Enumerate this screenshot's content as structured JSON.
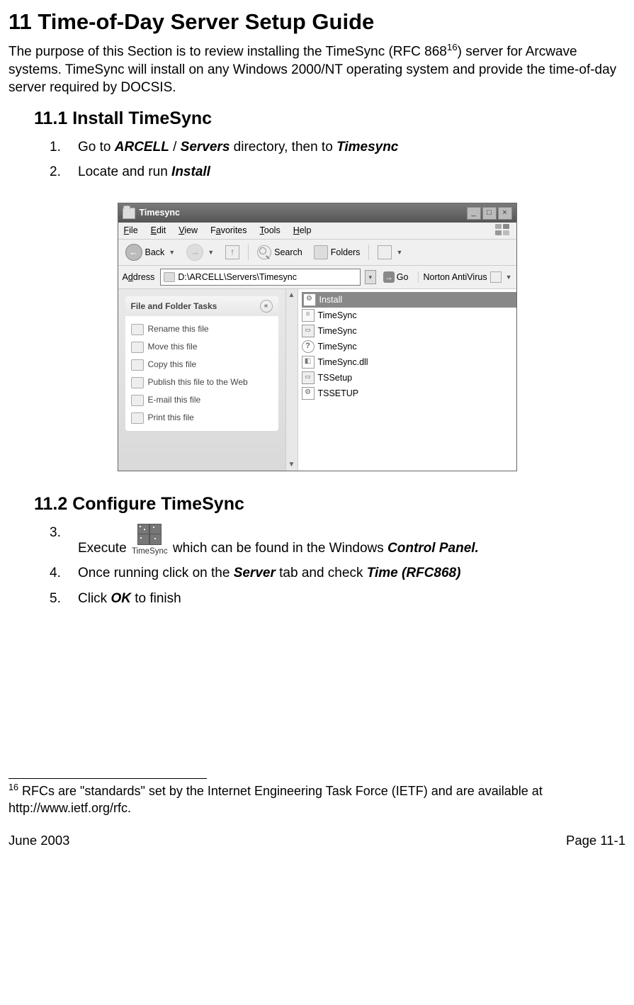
{
  "doc": {
    "h1": "11  Time-of-Day Server Setup Guide",
    "intro_a": "The purpose of this Section is to review installing the TimeSync (RFC 868",
    "intro_sup": "16",
    "intro_b": ") server for Arcwave systems.  TimeSync will install on any Windows 2000/NT operating system and provide the time-of-day server required by DOCSIS.",
    "h2_1": "11.1  Install TimeSync",
    "step1_num": "1.",
    "step1_a": "Go to ",
    "step1_b1": "ARCELL",
    "step1_b2": " / ",
    "step1_b3": "Servers",
    "step1_c": " directory, then to ",
    "step1_d": "Timesync",
    "step2_num": "2.",
    "step2_a": "Locate and run ",
    "step2_b": "Install",
    "h2_2": "11.2  Configure TimeSync",
    "step3_num": "3.",
    "step3_a": "Execute ",
    "step3_b": " which can be found in the Windows ",
    "step3_c": "Control Panel.",
    "step4_num": "4.",
    "step4_a": "Once running click on the ",
    "step4_b": "Server",
    "step4_c": " tab and check ",
    "step4_d": "Time (RFC868)",
    "step5_num": "5.",
    "step5_a": "Click ",
    "step5_b": "OK",
    "step5_c": " to finish",
    "footnote_num": "16",
    "footnote_text": " RFCs are \"standards\" set by the Internet Engineering Task Force (IETF) and are available at http://www.ietf.org/rfc.",
    "footer_left": "June 2003",
    "footer_right": "Page 11-1"
  },
  "explorer": {
    "title": "Timesync",
    "menu": {
      "file": "File",
      "edit": "Edit",
      "view": "View",
      "favorites": "Favorites",
      "tools": "Tools",
      "help": "Help"
    },
    "toolbar": {
      "back": "Back",
      "search": "Search",
      "folders": "Folders"
    },
    "address_label": "Address",
    "address_value": "D:\\ARCELL\\Servers\\Timesync",
    "go": "Go",
    "norton": "Norton AntiVirus",
    "tasks_header": "File and Folder Tasks",
    "tasks": {
      "rename": "Rename this file",
      "move": "Move this file",
      "copy": "Copy this file",
      "publish": "Publish this file to the Web",
      "email": "E-mail this file",
      "print": "Print this file"
    },
    "files": {
      "install": "Install",
      "ts1": "TimeSync",
      "ts2": "TimeSync",
      "ts3": "TimeSync",
      "dll": "TimeSync.dll",
      "tssetup1": "TSSetup",
      "tssetup2": "TSSETUP"
    }
  },
  "ts_icon_caption": "TimeSync"
}
